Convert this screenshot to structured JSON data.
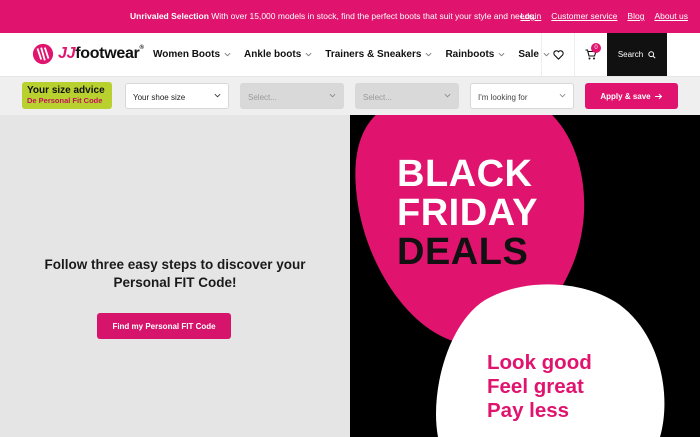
{
  "topbar": {
    "promo_bold": "Unrivaled Selection",
    "promo_text": " With over 15,000 models in stock, find the perfect boots that suit your style and needs.",
    "links": [
      "Login",
      "Customer service",
      "Blog",
      "About us"
    ]
  },
  "header": {
    "logo_brand_jj": "JJ",
    "logo_brand_text": "footwear",
    "logo_reg": "®",
    "nav": [
      "Women Boots",
      "Ankle boots",
      "Trainers & Sneakers",
      "Rainboots",
      "Sale"
    ],
    "cart_count": "0",
    "search_label": "Search"
  },
  "sizebar": {
    "advice_title": "Your size advice",
    "advice_subtitle": "De Personal Fit Code",
    "shoe_size_label": "Your shoe size",
    "select2_placeholder": "Select...",
    "select3_placeholder": "Select...",
    "looking_for_label": "I'm looking for",
    "apply_label": "Apply & save"
  },
  "hero_left": {
    "headline": "Follow three easy steps to discover your Personal FIT Code!",
    "button_label": "Find my Personal FIT Code"
  },
  "hero_right": {
    "line1": "BLACK",
    "line2": "FRIDAY",
    "line3": "DEALS",
    "slogan1": "Look good",
    "slogan2": "Feel great",
    "slogan3": "Pay less"
  },
  "colors": {
    "brand_pink": "#e0146e",
    "advice_green": "#b8d12e",
    "hero_black": "#000000"
  },
  "icons": [
    "heart-icon",
    "cart-icon",
    "search-icon",
    "chevron-down-icon",
    "arrow-right-icon",
    "logo-icon"
  ]
}
